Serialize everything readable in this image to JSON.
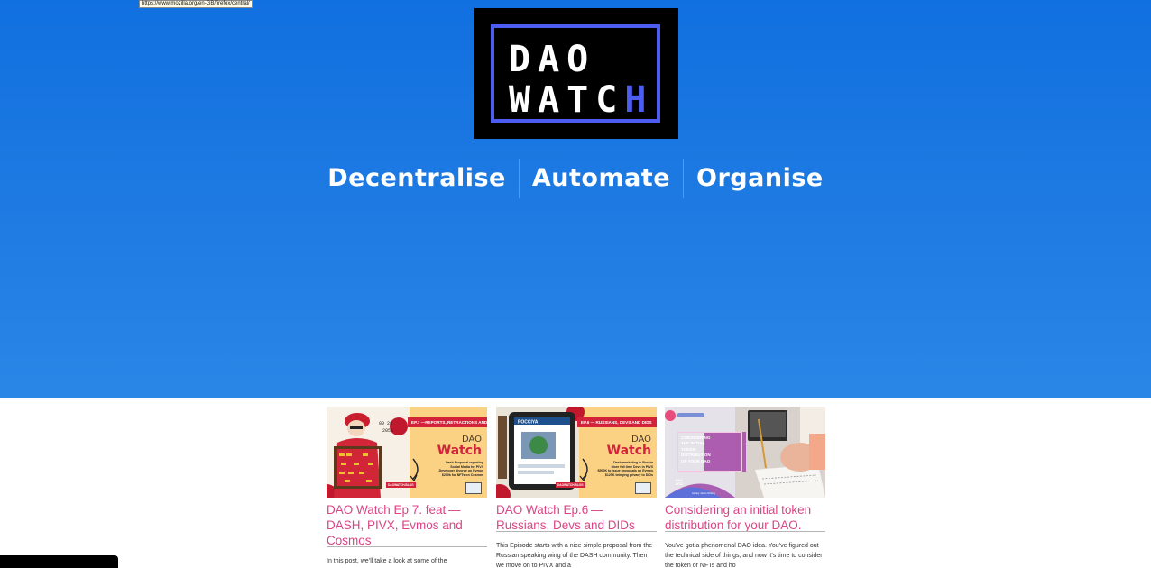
{
  "status_url": "https://www.mozilla.org/en-GB/firefox/central/",
  "logo": {
    "line1": "DAO",
    "line2": "WATC",
    "line2_last": "H",
    "accent_color": "#4d5df2"
  },
  "tagline": [
    "Decentralise",
    "Automate",
    "Organise"
  ],
  "colors": {
    "hero_top": "#1170e0",
    "hero_bottom": "#2a86e6",
    "title_pink": "#d94585",
    "thumb_red": "#d2233a",
    "thumb_yellow": "#fbd184"
  },
  "posts": [
    {
      "title": "DAO Watch Ep 7. feat — DASH, PIVX, Evmos and Cosmos",
      "excerpt": "In this post, we’ll take a look at some of the",
      "thumb": {
        "banner": "EP.7 —REPORTS, RETRACTIONS AND NFTS",
        "brand_top": "DAO",
        "brand_bottom": "Watch",
        "bullets": "Dash Proposal reporting\nSocial Media for PIVX\nDeveloper divorce on Evmos\n$200k for NFTs on Cosmos",
        "pill": "DAOWATCH.BLOG",
        "counter": "00 20\n2055"
      }
    },
    {
      "title": "DAO Watch Ep.6 — Russians, Devs and DIDs",
      "excerpt": "This Episode starts with a nice simple proposal from the Russian speaking wing of the DASH community. Then we move on to PIVX and a",
      "thumb": {
        "banner": "EP.6 — RUSSIANS, DEVS AND DIDS",
        "brand_top": "DAO",
        "brand_bottom": "Watch",
        "bullets": "Dash marketing in Russia\nMore full time Devs in PIVX\n$500K to issue proposals on Evmos\n$125K bringing privacy to DIDs",
        "pill": "DAOWATCH.BLOG",
        "screen_label": "POCCIYA"
      }
    },
    {
      "title": "Considering an initial token distribution for your DAO.",
      "excerpt": "You’ve got a phenomenal DAO idea. You’ve figured out the technical side of things, and now it’s time to consider the token or NFTs and ho",
      "thumb": {
        "heading": "CONSIDERING\nTHE INITIAL\nTOKEN\nDISTRIBUTION\nOF YOUR DAO",
        "footer_logo": "DAO\nWTC",
        "footer_text": "Ashley Jarvis Writing"
      }
    }
  ]
}
